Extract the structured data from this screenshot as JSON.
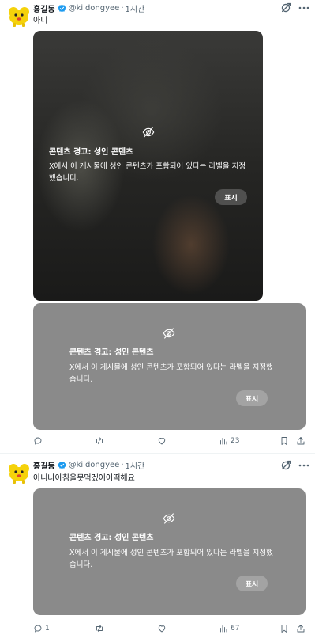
{
  "posts": [
    {
      "author_name": "홍길동",
      "handle": "@kildongyee",
      "separator": "·",
      "time": "1시간",
      "text": "아니",
      "media": [
        {
          "warning_title": "콘텐츠 경고: 성인 콘텐츠",
          "warning_desc": "X에서 이 게시물에 성인 콘텐츠가 포함되어 있다는 라벨을 지정했습니다.",
          "show_label": "표시"
        },
        {
          "warning_title": "콘텐츠 경고: 성인 콘텐츠",
          "warning_desc": "X에서 이 게시물에 성인 콘텐츠가 포함되어 있다는 라벨을 지정했습니다.",
          "show_label": "표시"
        }
      ],
      "replies": "",
      "retweets": "",
      "likes": "",
      "views": "23"
    },
    {
      "author_name": "홍길동",
      "handle": "@kildongyee",
      "separator": "·",
      "time": "1시간",
      "text": "아니나아침을못먹겠어어떡해요",
      "media": [
        {
          "warning_title": "콘텐츠 경고: 성인 콘텐츠",
          "warning_desc": "X에서 이 게시물에 성인 콘텐츠가 포함되어 있다는 라벨을 지정했습니다.",
          "show_label": "표시"
        }
      ],
      "replies": "1",
      "retweets": "",
      "likes": "",
      "views": "67"
    }
  ],
  "icons": {
    "verified": "verified-badge-icon",
    "grok": "grok-icon",
    "more": "more-icon",
    "hidden": "eye-slash-icon",
    "reply": "reply-icon",
    "retweet": "retweet-icon",
    "like": "heart-icon",
    "views": "views-icon",
    "bookmark": "bookmark-icon",
    "share": "share-icon"
  },
  "colors": {
    "verified_blue": "#1d9bf0",
    "avatar_yellow": "#f5d20a",
    "muted_text": "#536471",
    "sensitive_gray": "#8a8a8a"
  }
}
